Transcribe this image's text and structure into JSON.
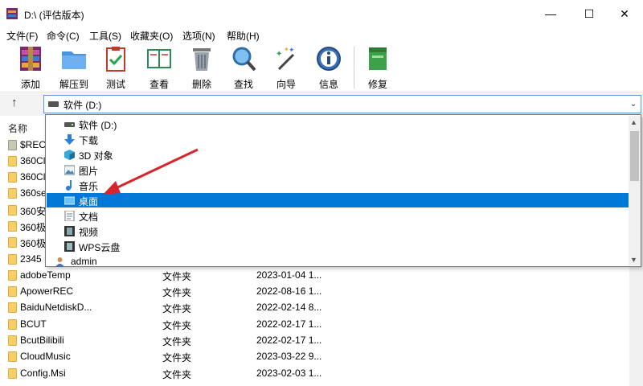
{
  "window": {
    "title": "D:\\ (评估版本)",
    "minimize": "—",
    "maximize": "☐",
    "close": "✕"
  },
  "menu": [
    "文件(F)",
    "命令(C)",
    "工具(S)",
    "收藏夹(O)",
    "选项(N)",
    "帮助(H)"
  ],
  "toolbar": [
    {
      "label": "添加",
      "icon": "add-archive-icon"
    },
    {
      "label": "解压到",
      "icon": "extract-to-icon"
    },
    {
      "label": "测试",
      "icon": "test-icon"
    },
    {
      "label": "查看",
      "icon": "view-book-icon"
    },
    {
      "label": "删除",
      "icon": "delete-trash-icon"
    },
    {
      "label": "查找",
      "icon": "find-magnifier-icon"
    },
    {
      "label": "向导",
      "icon": "wizard-wand-icon"
    },
    {
      "label": "信息",
      "icon": "info-icon"
    },
    {
      "label": "修复",
      "icon": "repair-icon"
    }
  ],
  "address": {
    "up": "↑",
    "text": "软件 (D:)",
    "dropdown_arrow": "⌄"
  },
  "list": {
    "column_name": "名称",
    "hidden_items": [
      "$REC",
      "360Cl",
      "360Cl",
      "360se",
      "360安",
      "360极",
      "360极",
      "2345"
    ],
    "rows": [
      {
        "name": "adobeTemp",
        "type": "文件夹",
        "date": "2023-01-04 1..."
      },
      {
        "name": "ApowerREC",
        "type": "文件夹",
        "date": "2022-08-16 1..."
      },
      {
        "name": "BaiduNetdiskD...",
        "type": "文件夹",
        "date": "2022-02-14 8..."
      },
      {
        "name": "BCUT",
        "type": "文件夹",
        "date": "2022-02-17 1..."
      },
      {
        "name": "BcutBilibili",
        "type": "文件夹",
        "date": "2022-02-17 1..."
      },
      {
        "name": "CloudMusic",
        "type": "文件夹",
        "date": "2023-03-22 9..."
      },
      {
        "name": "Config.Msi",
        "type": "文件夹",
        "date": "2023-02-03 1..."
      }
    ]
  },
  "dropdown": {
    "items": [
      {
        "label": "软件 (D:)",
        "icon": "drive-icon",
        "selected": false
      },
      {
        "label": "下载",
        "icon": "download-arrow-icon",
        "selected": false
      },
      {
        "label": "3D 对象",
        "icon": "3d-objects-icon",
        "selected": false
      },
      {
        "label": "图片",
        "icon": "pictures-icon",
        "selected": false
      },
      {
        "label": "音乐",
        "icon": "music-note-icon",
        "selected": false
      },
      {
        "label": "桌面",
        "icon": "desktop-icon",
        "selected": true
      },
      {
        "label": "文档",
        "icon": "documents-icon",
        "selected": false
      },
      {
        "label": "视频",
        "icon": "videos-icon",
        "selected": false
      },
      {
        "label": "WPS云盘",
        "icon": "wps-cloud-icon",
        "selected": false
      },
      {
        "label": "admin",
        "icon": "user-icon",
        "selected": false
      }
    ],
    "scroll_up": "▲",
    "scroll_down": "▼"
  },
  "colors": {
    "accent": "#0078d7",
    "arrow": "#d6262b",
    "folder": "#f6cf68"
  }
}
